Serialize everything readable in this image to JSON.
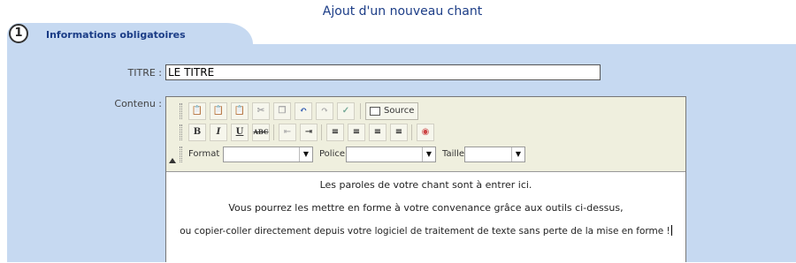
{
  "page": {
    "title": "Ajout d'un nouveau chant"
  },
  "tab": {
    "step": "1",
    "label": "Informations obligatoires"
  },
  "form": {
    "titre_label": "TITRE :",
    "titre_value": "LE TITRE",
    "contenu_label": "Contenu :"
  },
  "editor": {
    "toolbar": {
      "source_label": "Source",
      "bold": "B",
      "italic": "I",
      "underline": "U",
      "strike": "ABC",
      "format_label": "Format",
      "format_value": "",
      "police_label": "Police",
      "police_value": "",
      "taille_label": "Taille",
      "taille_value": ""
    },
    "content_lines": [
      "Les paroles de votre chant sont à entrer ici.",
      "Vous pourrez les mettre en forme à votre convenance grâce aux outils ci-dessus,",
      "ou copier-coller directement depuis votre logiciel de traitement de texte sans perte de la mise en forme !"
    ]
  }
}
